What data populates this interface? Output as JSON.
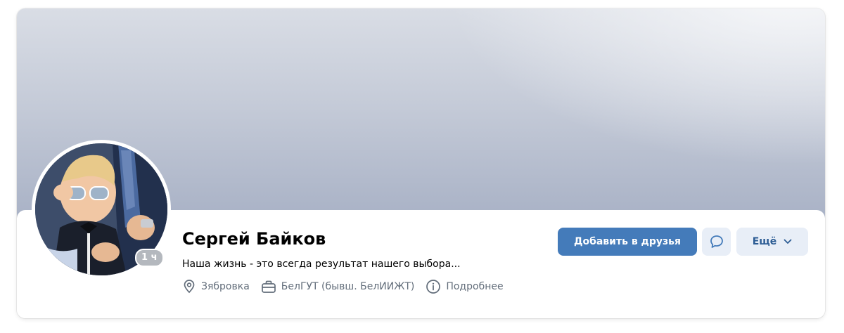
{
  "profile": {
    "name": "Сергей Байков",
    "status": "Наша жизнь - это всегда результат нашего выбора...",
    "online_ago": "1 ч",
    "location": "Зябровка",
    "education": "БелГУТ (бывш. БелИИЖТ)",
    "details_link": "Подробнее"
  },
  "actions": {
    "add_friend": "Добавить в друзья",
    "more": "Ещё"
  },
  "icons": {
    "location": "location-pin-icon",
    "education": "briefcase-icon",
    "details": "info-circle-icon",
    "message": "message-bubble-icon",
    "more": "chevron-down-icon"
  },
  "colors": {
    "primary_button": "#447bba",
    "secondary_button": "#e8eef7",
    "secondary_text": "#2c5c94",
    "meta_text": "#626d7a"
  }
}
